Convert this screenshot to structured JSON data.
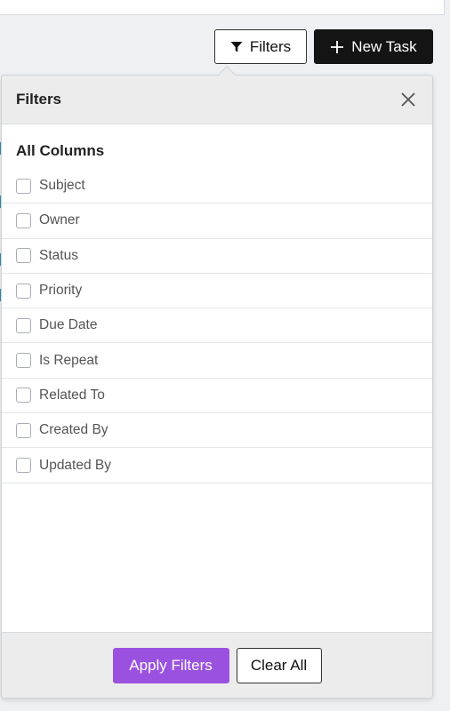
{
  "colors": {
    "accent": "#9b51e0",
    "primary_dark": "#141414",
    "panel_header_bg": "#ececec"
  },
  "toolbar": {
    "filters_label": "Filters",
    "filters_icon": "funnel-icon",
    "new_task_label": "New Task",
    "new_task_icon": "plus-icon"
  },
  "filter_panel": {
    "title": "Filters",
    "close_icon": "close-icon",
    "section_title": "All Columns",
    "columns": [
      {
        "label": "Subject",
        "checked": false
      },
      {
        "label": "Owner",
        "checked": false
      },
      {
        "label": "Status",
        "checked": false
      },
      {
        "label": "Priority",
        "checked": false
      },
      {
        "label": "Due Date",
        "checked": false
      },
      {
        "label": "Is Repeat",
        "checked": false
      },
      {
        "label": "Related To",
        "checked": false
      },
      {
        "label": "Created By",
        "checked": false
      },
      {
        "label": "Updated By",
        "checked": false
      }
    ],
    "apply_label": "Apply Filters",
    "clear_label": "Clear All"
  }
}
